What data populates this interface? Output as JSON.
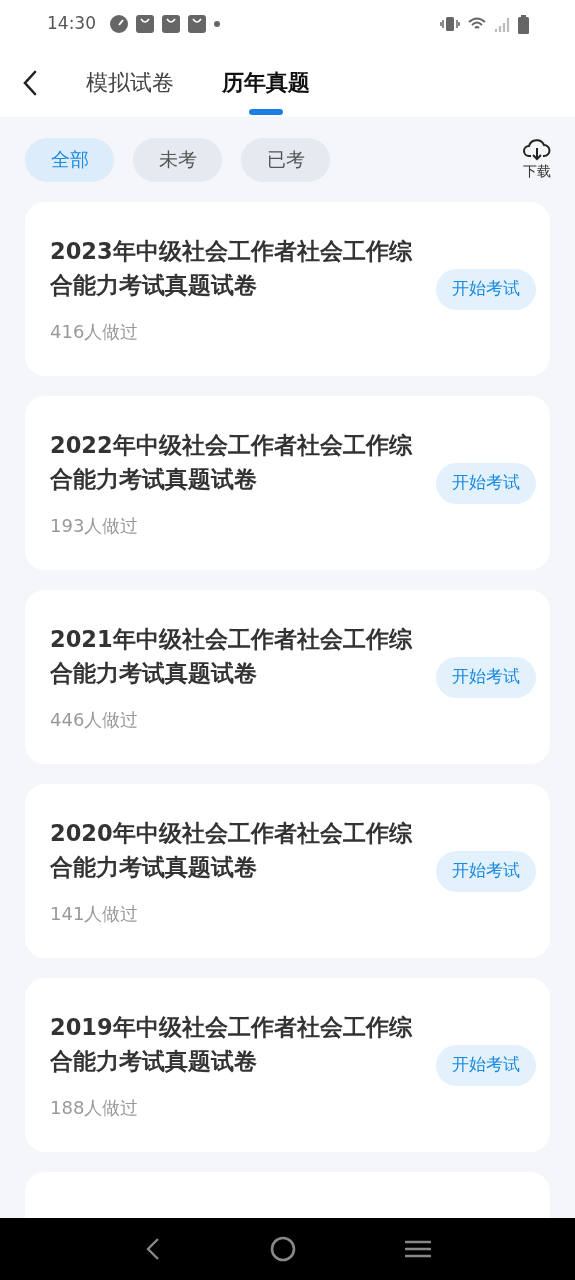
{
  "status_bar": {
    "time": "14:30"
  },
  "tabs": [
    {
      "label": "模拟试卷",
      "selected": false
    },
    {
      "label": "历年真题",
      "selected": true
    }
  ],
  "filters": [
    {
      "label": "全部",
      "selected": true
    },
    {
      "label": "未考",
      "selected": false
    },
    {
      "label": "已考",
      "selected": false
    }
  ],
  "download": {
    "label": "下载"
  },
  "papers": [
    {
      "title": "2023年中级社会工作者社会工作综合能力考试真题试卷",
      "count": "416人做过",
      "button": "开始考试"
    },
    {
      "title": "2022年中级社会工作者社会工作综合能力考试真题试卷",
      "count": "193人做过",
      "button": "开始考试"
    },
    {
      "title": "2021年中级社会工作者社会工作综合能力考试真题试卷",
      "count": "446人做过",
      "button": "开始考试"
    },
    {
      "title": "2020年中级社会工作者社会工作综合能力考试真题试卷",
      "count": "141人做过",
      "button": "开始考试"
    },
    {
      "title": "2019年中级社会工作者社会工作综合能力考试真题试卷",
      "count": "188人做过",
      "button": "开始考试"
    }
  ]
}
